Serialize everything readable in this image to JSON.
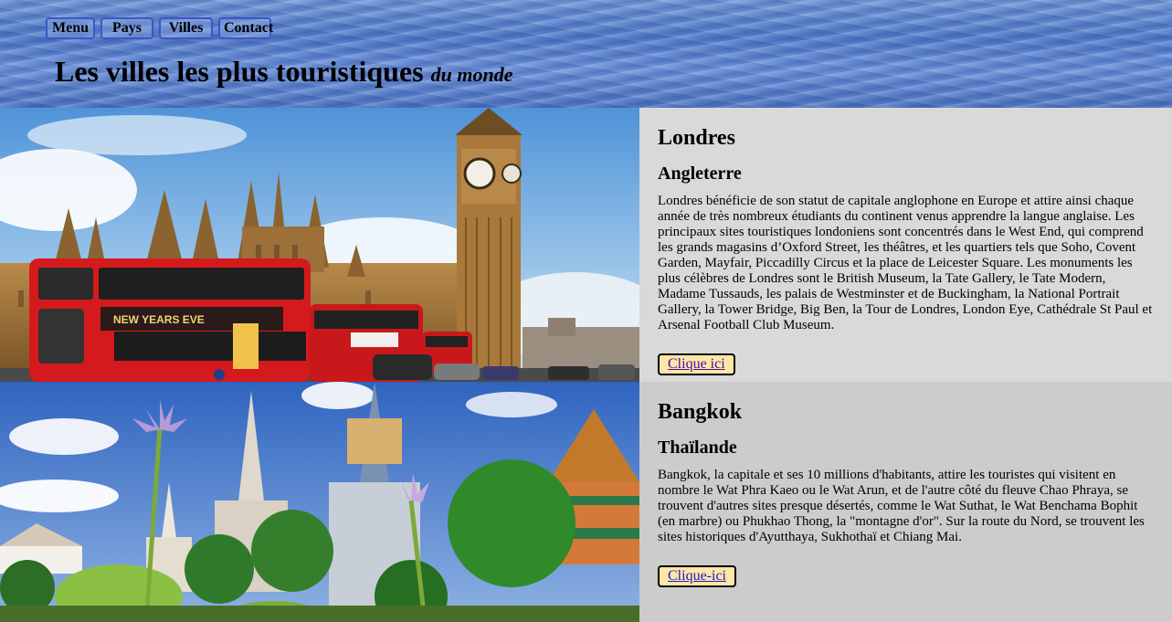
{
  "nav": {
    "items": [
      "Menu",
      "Pays",
      "Villes",
      "Contact"
    ]
  },
  "header": {
    "title": "Les villes les plus touristiques",
    "subtitle": "du monde"
  },
  "cities": [
    {
      "name": "Londres",
      "country": "Angleterre",
      "description": "Londres bénéficie de son statut de capitale anglophone en Europe et attire ainsi chaque année de très nombreux étudiants du continent venus apprendre la langue anglaise. Les principaux sites touristiques londoniens sont concentrés dans le West End, qui comprend les grands magasins d’Oxford Street, les théâtres, et les quartiers tels que Soho, Covent Garden, Mayfair, Piccadilly Circus et la place de Leicester Square. Les monuments les plus célèbres de Londres sont le British Museum, la Tate Gallery, le Tate Modern, Madame Tussauds, les palais de Westminster et de Buckingham, la National Portrait Gallery, la Tower Bridge, Big Ben, la Tour de Londres, London Eye, Cathédrale St Paul et Arsenal Football Club Museum.",
      "button": "Clique ici",
      "bus_banner": "NEW YEARS EVE"
    },
    {
      "name": "Bangkok",
      "country": "Thaïlande",
      "description": "Bangkok, la capitale et ses 10 millions d'habitants, attire les touristes qui visitent en nombre le Wat Phra Kaeo ou le Wat Arun, et de l'autre côté du fleuve Chao Phraya, se trouvent d'autres sites presque désertés, comme le Wat Suthat, le Wat Benchama Bophit (en marbre) ou Phukhao Thong, la \"montagne d'or\". Sur la route du Nord, se trouvent les sites historiques d'Ayutthaya, Sukhothaï et Chiang Mai.",
      "button": "Clique-ici"
    }
  ]
}
